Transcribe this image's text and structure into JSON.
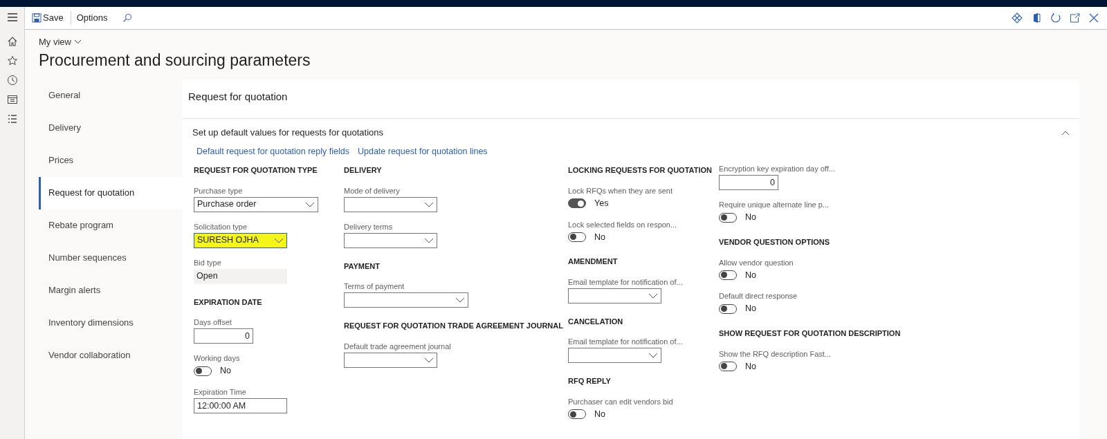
{
  "toolbar": {
    "save": "Save",
    "options": "Options"
  },
  "page": {
    "view": "My view",
    "title": "Procurement and sourcing parameters"
  },
  "tabs": [
    {
      "label": "General",
      "selected": false
    },
    {
      "label": "Delivery",
      "selected": false
    },
    {
      "label": "Prices",
      "selected": false
    },
    {
      "label": "Request for quotation",
      "selected": true
    },
    {
      "label": "Rebate program",
      "selected": false
    },
    {
      "label": "Number sequences",
      "selected": false
    },
    {
      "label": "Margin alerts",
      "selected": false
    },
    {
      "label": "Inventory dimensions",
      "selected": false
    },
    {
      "label": "Vendor collaboration",
      "selected": false
    }
  ],
  "panel": {
    "title": "Request for quotation",
    "fasttab": {
      "title": "Set up default values for requests for quotations",
      "expanded": true,
      "links": [
        "Default request for quotation reply fields",
        "Update request for quotation lines"
      ],
      "columns": [
        {
          "sections": [
            {
              "heading": "REQUEST FOR QUOTATION TYPE",
              "fields": [
                {
                  "kind": "dropdown",
                  "label": "Purchase type",
                  "value": "Purchase order",
                  "wide": true,
                  "highlighted": false
                },
                {
                  "kind": "dropdown",
                  "label": "Solicitation type",
                  "value": "SURESH OJHA",
                  "highlighted": true
                },
                {
                  "kind": "readonly",
                  "label": "Bid type",
                  "value": "Open"
                }
              ]
            },
            {
              "heading": "EXPIRATION DATE",
              "fields": [
                {
                  "kind": "number",
                  "label": "Days offset",
                  "value": "0"
                },
                {
                  "kind": "toggle",
                  "label": "Working days",
                  "on": false,
                  "value": "No"
                },
                {
                  "kind": "text",
                  "label": "Expiration Time",
                  "value": "12:00:00 AM"
                }
              ]
            }
          ]
        },
        {
          "sections": [
            {
              "heading": "DELIVERY",
              "fields": [
                {
                  "kind": "dropdown",
                  "label": "Mode of delivery",
                  "highlighted": false
                },
                {
                  "kind": "dropdown",
                  "label": "Delivery terms",
                  "highlighted": false
                }
              ]
            },
            {
              "heading": "PAYMENT",
              "fields": [
                {
                  "kind": "dropdown",
                  "label": "Terms of payment",
                  "wide": true,
                  "highlighted": false
                }
              ]
            },
            {
              "heading": "REQUEST FOR QUOTATION TRADE AGREEMENT JOURNAL",
              "fields": [
                {
                  "kind": "dropdown",
                  "label": "Default trade agreement journal",
                  "highlighted": false
                }
              ]
            }
          ]
        },
        {
          "sections": [
            {
              "heading": "LOCKING REQUESTS FOR QUOTATION",
              "fields": [
                {
                  "kind": "toggle",
                  "label": "Lock RFQs when they are sent",
                  "on": true,
                  "value": "Yes"
                },
                {
                  "kind": "toggle",
                  "label": "Lock selected fields on respon...",
                  "on": false,
                  "value": "No"
                }
              ]
            },
            {
              "heading": "AMENDMENT",
              "fields": [
                {
                  "kind": "dropdown",
                  "label": "Email template for notification of...",
                  "highlighted": false
                }
              ]
            },
            {
              "heading": "CANCELATION",
              "fields": [
                {
                  "kind": "dropdown",
                  "label": "Email template for notification of...",
                  "highlighted": false
                }
              ]
            },
            {
              "heading": "RFQ REPLY",
              "fields": [
                {
                  "kind": "toggle",
                  "label": "Purchaser can edit vendors bid",
                  "on": false,
                  "value": "No"
                }
              ]
            }
          ]
        },
        {
          "sections": [
            {
              "fields": [
                {
                  "kind": "number",
                  "label": "Encryption key expiration day off...",
                  "value": "0"
                },
                {
                  "kind": "toggle",
                  "label": "Require unique alternate line p...",
                  "on": false,
                  "value": "No"
                }
              ]
            },
            {
              "heading": "VENDOR QUESTION OPTIONS",
              "fields": [
                {
                  "kind": "toggle",
                  "label": "Allow vendor question",
                  "on": false,
                  "value": "No"
                },
                {
                  "kind": "toggle",
                  "label": "Default direct response",
                  "on": false,
                  "value": "No"
                }
              ]
            },
            {
              "heading": "SHOW REQUEST FOR QUOTATION DESCRIPTION",
              "fields": [
                {
                  "kind": "toggle",
                  "label": "Show the RFQ description Fast...",
                  "on": false,
                  "value": "No"
                }
              ]
            }
          ]
        }
      ]
    }
  }
}
